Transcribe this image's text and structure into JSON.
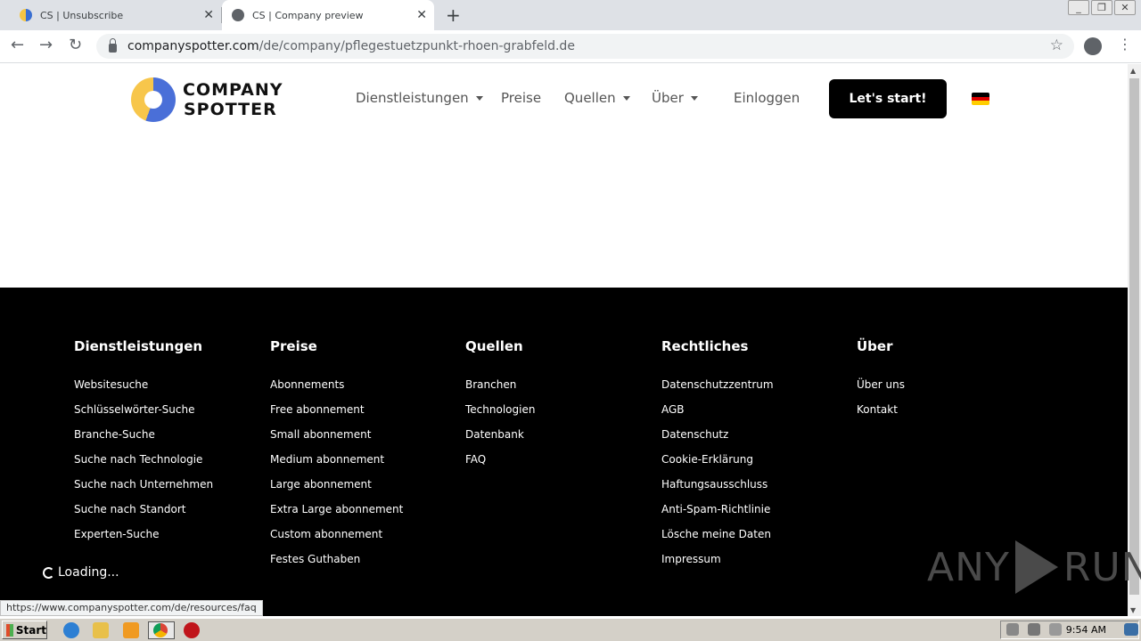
{
  "browser": {
    "tabs": [
      {
        "title": "CS | Unsubscribe"
      },
      {
        "title": "CS | Company preview"
      }
    ],
    "url_host": "companyspotter.com",
    "url_path": "/de/company/pflegestuetzpunkt-rhoen-grabfeld.de",
    "status_url": "https://www.companyspotter.com/de/resources/faq"
  },
  "header": {
    "logo_line1": "COMPANY",
    "logo_line2": "SPOTTER",
    "nav": {
      "services": "Dienstleistungen",
      "prices": "Preise",
      "sources": "Quellen",
      "about": "Über",
      "login": "Einloggen"
    },
    "cta": "Let's start!",
    "flag_colors": [
      "#000000",
      "#dd0000",
      "#ffce00"
    ]
  },
  "footer": {
    "columns": [
      {
        "heading": "Dienstleistungen",
        "links": [
          "Websitesuche",
          "Schlüsselwörter-Suche",
          "Branche-Suche",
          "Suche nach Technologie",
          "Suche nach Unternehmen",
          "Suche nach Standort",
          "Experten-Suche"
        ]
      },
      {
        "heading": "Preise",
        "links": [
          "Abonnements",
          "Free abonnement",
          "Small abonnement",
          "Medium abonnement",
          "Large abonnement",
          "Extra Large abonnement",
          "Custom abonnement",
          "Festes Guthaben"
        ]
      },
      {
        "heading": "Quellen",
        "links": [
          "Branchen",
          "Technologien",
          "Datenbank",
          "FAQ"
        ]
      },
      {
        "heading": "Rechtliches",
        "links": [
          "Datenschutzzentrum",
          "AGB",
          "Datenschutz",
          "Cookie-Erklärung",
          "Haftungsausschluss",
          "Anti-Spam-Richtlinie",
          "Lösche meine Daten",
          "Impressum"
        ]
      },
      {
        "heading": "Über",
        "links": [
          "Über uns",
          "Kontakt"
        ]
      }
    ]
  },
  "loading_text": "Loading...",
  "watermark": {
    "left": "ANY",
    "right": "RUN"
  },
  "taskbar": {
    "start": "Start",
    "clock": "9:54 AM"
  }
}
